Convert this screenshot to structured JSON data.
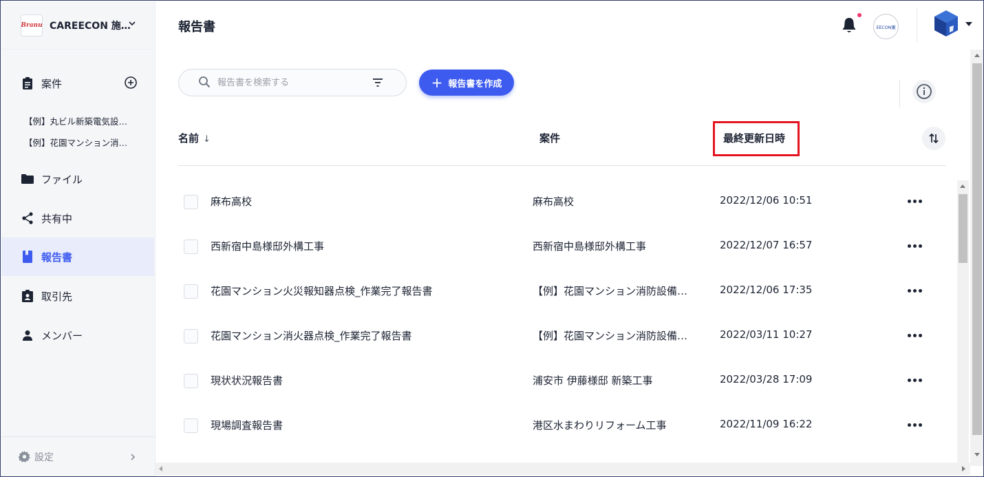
{
  "org": {
    "logo_text": "Branu",
    "name": "CAREECON 施…"
  },
  "header": {
    "title": "報告書",
    "org_avatar_text": "EECON東"
  },
  "sidebar": {
    "projects_label": "案件",
    "project_items": [
      {
        "label": "【例】丸ビル新築電気設…"
      },
      {
        "label": "【例】花園マンション消…"
      }
    ],
    "items": [
      {
        "label": "ファイル"
      },
      {
        "label": "共有中"
      },
      {
        "label": "報告書"
      },
      {
        "label": "取引先"
      },
      {
        "label": "メンバー"
      }
    ],
    "active_item": "報告書",
    "settings_label": "設定"
  },
  "toolbar": {
    "search_placeholder": "報告書を検索する",
    "search_value": "",
    "create_label": "報告書を作成"
  },
  "table": {
    "columns": {
      "name": "名前",
      "project": "案件",
      "updated": "最終更新日時"
    },
    "name_sort_indicator": "↓",
    "rows": [
      {
        "name": "麻布高校",
        "project": "麻布高校",
        "updated": "2022/12/06 10:51"
      },
      {
        "name": "西新宿中島様邸外構工事",
        "project": "西新宿中島様邸外構工事",
        "updated": "2022/12/07 16:57"
      },
      {
        "name": "花園マンション火災報知器点検_作業完了報告書",
        "project": "【例】花園マンション消防設備…",
        "updated": "2022/12/06 17:35"
      },
      {
        "name": "花園マンション消火器点検_作業完了報告書",
        "project": "【例】花園マンション消防設備…",
        "updated": "2022/03/11 10:27"
      },
      {
        "name": "現状状況報告書",
        "project": "浦安市 伊藤様邸 新築工事",
        "updated": "2022/03/28 17:09"
      },
      {
        "name": "現場調査報告書",
        "project": "港区水まわりリフォーム工事",
        "updated": "2022/11/09 16:22"
      }
    ]
  },
  "colors": {
    "accent": "#3e5bf0",
    "highlight": "#e3141f",
    "notification": "#f0386b",
    "sidebar_bg": "#f5f6f8"
  }
}
